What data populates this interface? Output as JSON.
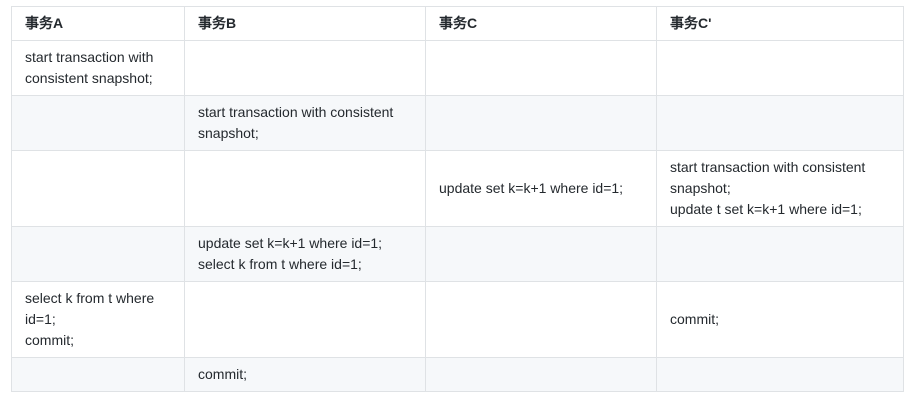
{
  "table": {
    "headers": [
      "事务A",
      "事务B",
      "事务C",
      "事务C'"
    ],
    "rows": [
      [
        [
          "start transaction with consistent snapshot;"
        ],
        [],
        [],
        []
      ],
      [
        [],
        [
          "start transaction with consistent snapshot;"
        ],
        [],
        []
      ],
      [
        [],
        [],
        [
          "update set k=k+1 where id=1;"
        ],
        [
          "start transaction with consistent snapshot;",
          "update t set k=k+1 where id=1;"
        ]
      ],
      [
        [],
        [
          "update set k=k+1 where id=1;",
          "select k from t where id=1;"
        ],
        [],
        []
      ],
      [
        [
          "select k from t where id=1;",
          "commit;"
        ],
        [],
        [],
        [
          "commit;"
        ]
      ],
      [
        [],
        [
          "commit;"
        ],
        [],
        []
      ]
    ]
  }
}
